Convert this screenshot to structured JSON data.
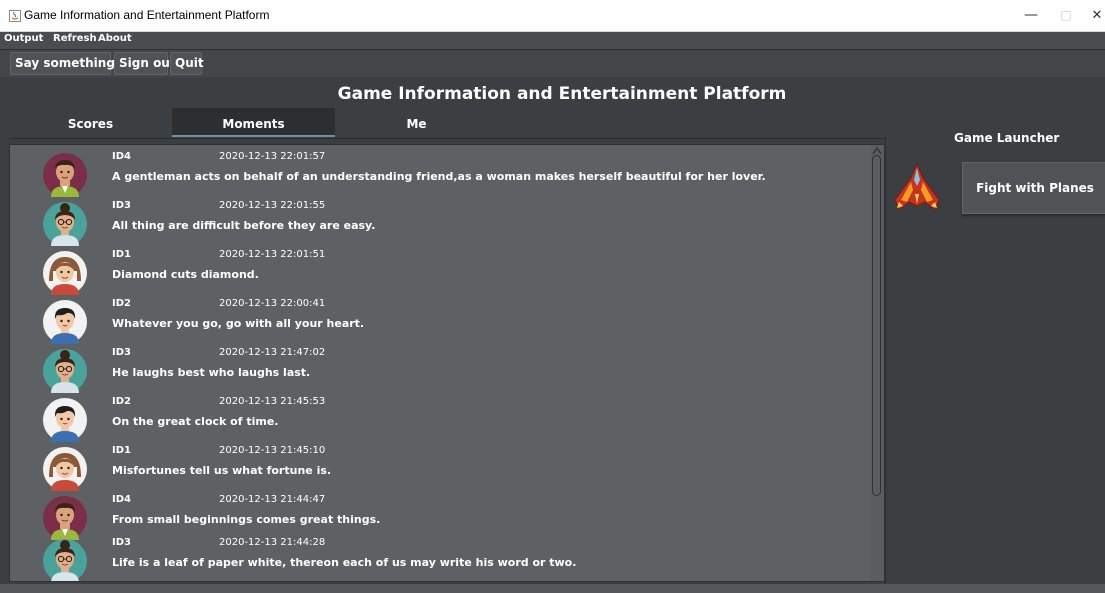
{
  "window": {
    "title": "Game Information and Entertainment Platform"
  },
  "menu": {
    "items": [
      "Output",
      "Refresh",
      "About"
    ]
  },
  "toolbar": {
    "say": "Say something...",
    "signout": "Sign out",
    "quit": "Quit"
  },
  "header": {
    "title": "Game Information and Entertainment Platform"
  },
  "tabs": [
    {
      "label": "Scores"
    },
    {
      "label": "Moments"
    },
    {
      "label": "Me"
    }
  ],
  "active_tab": "Moments",
  "moments": [
    {
      "user": "ID4",
      "time": "2020-12-13 22:01:57",
      "text": "A gentleman acts on behalf of an understanding friend,as a woman makes herself beautiful for her lover.",
      "avatar": "man-avatar-icon"
    },
    {
      "user": "ID3",
      "time": "2020-12-13 22:01:55",
      "text": "All thing are difficult before they are easy.",
      "avatar": "woman-glasses-avatar-icon"
    },
    {
      "user": "ID1",
      "time": "2020-12-13 22:01:51",
      "text": "Diamond cuts diamond.",
      "avatar": "girl-avatar-icon"
    },
    {
      "user": "ID2",
      "time": "2020-12-13 22:00:41",
      "text": "Whatever you go, go with all your heart.",
      "avatar": "boy-avatar-icon"
    },
    {
      "user": "ID3",
      "time": "2020-12-13 21:47:02",
      "text": "He laughs best who laughs last.",
      "avatar": "woman-glasses-avatar-icon"
    },
    {
      "user": "ID2",
      "time": "2020-12-13 21:45:53",
      "text": "On the great clock of time.",
      "avatar": "boy-avatar-icon"
    },
    {
      "user": "ID1",
      "time": "2020-12-13 21:45:10",
      "text": "Misfortunes tell us what fortune is.",
      "avatar": "girl-avatar-icon"
    },
    {
      "user": "ID4",
      "time": "2020-12-13 21:44:47",
      "text": "From small beginnings comes great things.",
      "avatar": "man-avatar-icon"
    },
    {
      "user": "ID3",
      "time": "2020-12-13 21:44:28",
      "text": "Life is a leaf of paper white, thereon each of us may write his word or two.",
      "avatar": "woman-glasses-avatar-icon"
    }
  ],
  "launcher": {
    "title": "Game Launcher",
    "game_button": "Fight with Planes",
    "game_icon": "plane-icon"
  },
  "colors": {
    "background": "#3c3f41",
    "panel": "#5e6164",
    "text": "#ffffff",
    "accent": "#6f8ea6"
  }
}
